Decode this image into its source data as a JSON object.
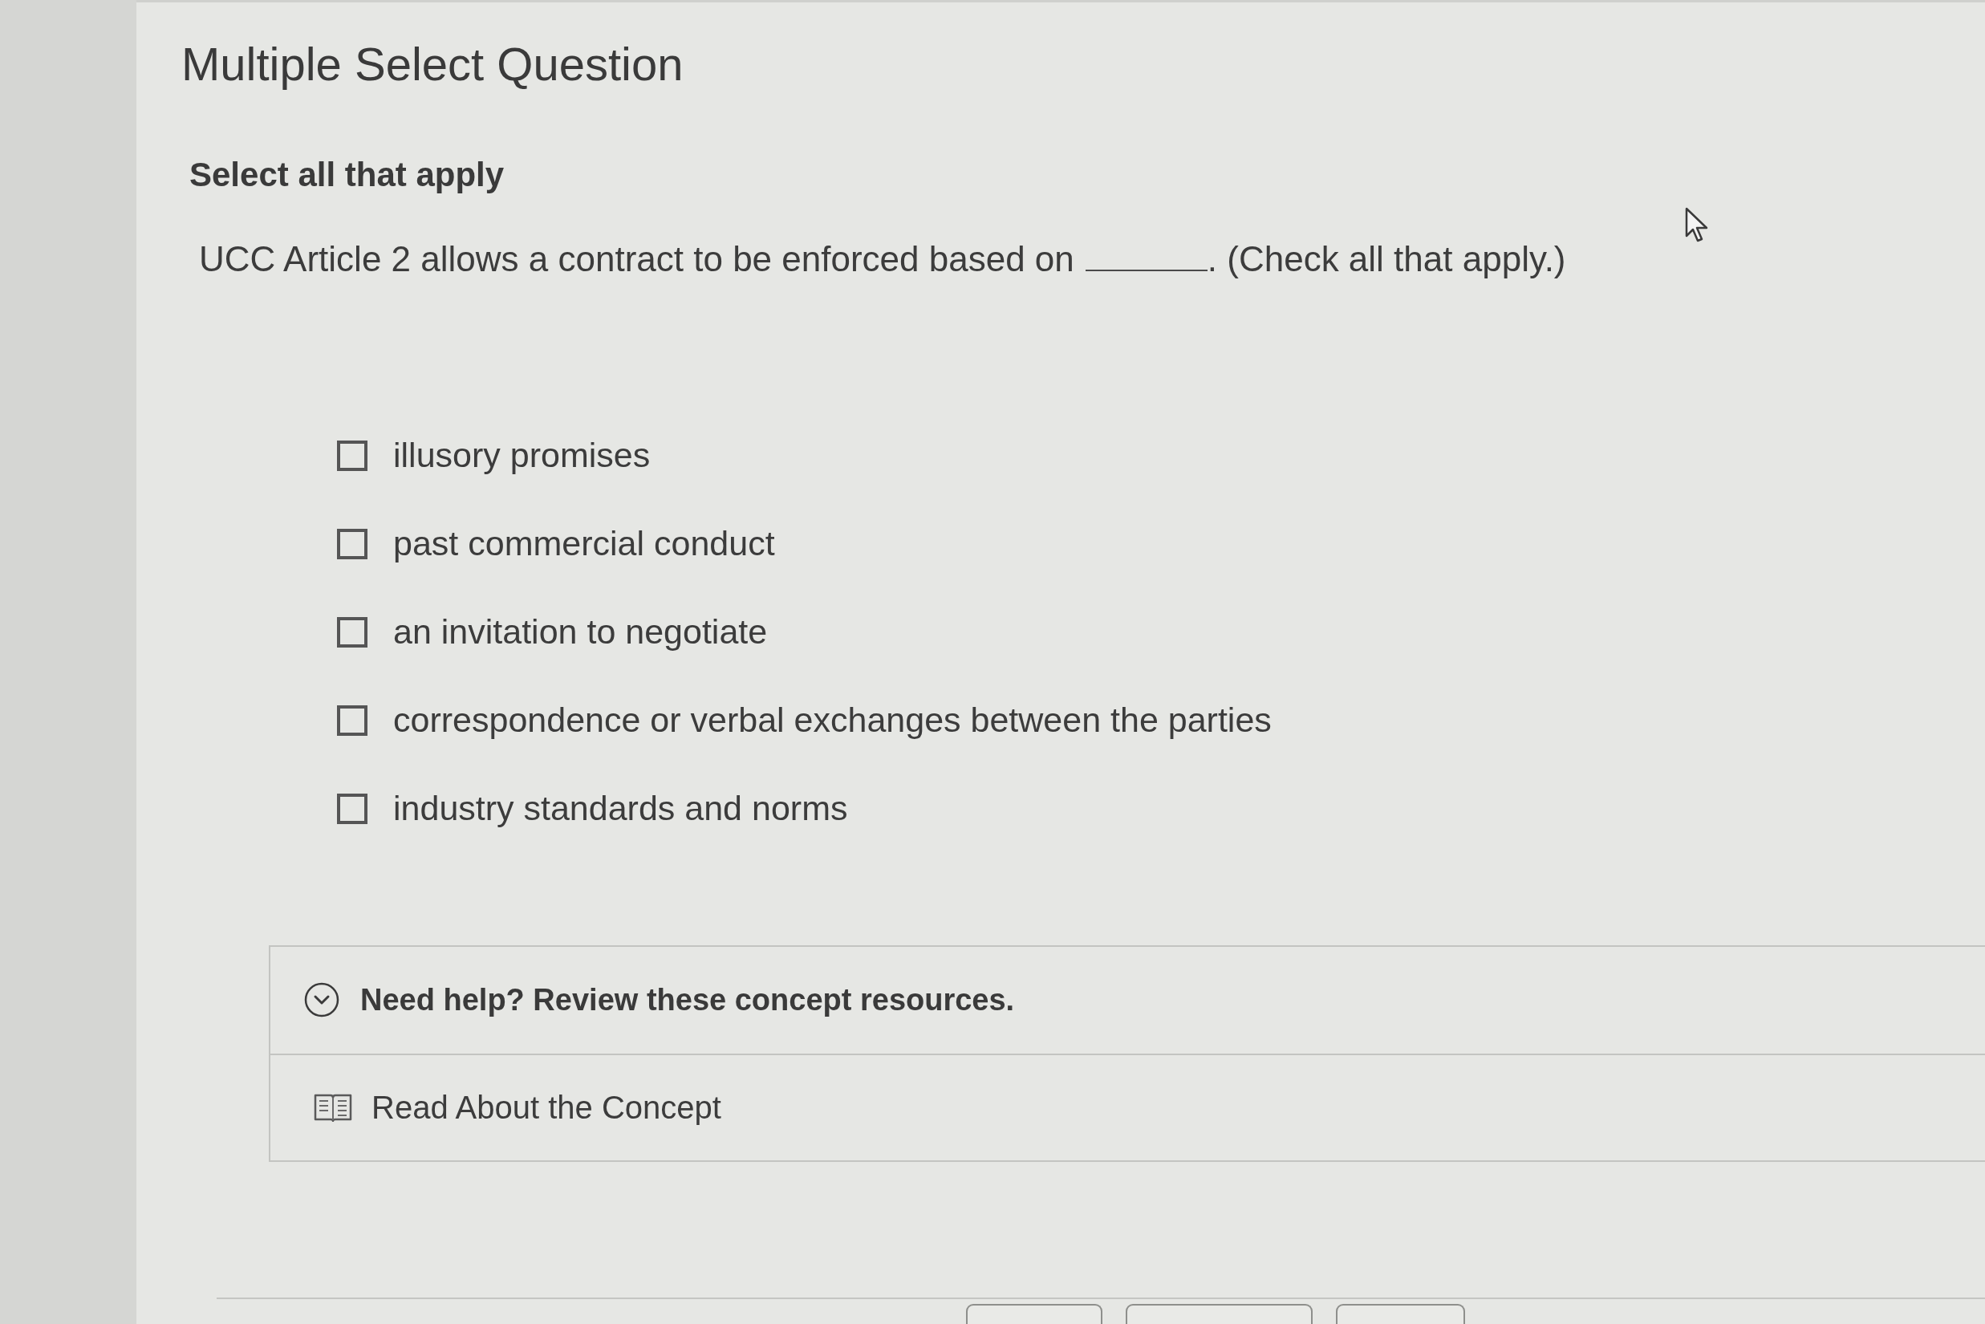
{
  "question_header": {
    "title": "Multiple Select Question"
  },
  "instruction": "Select all that apply",
  "prompt": [
    {
      "kind": "text",
      "text": "UCC Article 2 allows a contract to be enforced based on"
    },
    {
      "kind": "blank"
    },
    {
      "kind": "text",
      "text": ". (Check all that apply.)"
    }
  ],
  "options": [
    {
      "label": "illusory promises",
      "checked": false
    },
    {
      "label": "past commercial conduct",
      "checked": false
    },
    {
      "label": "an invitation to negotiate",
      "checked": false
    },
    {
      "label": "correspondence or verbal exchanges between the parties",
      "checked": false
    },
    {
      "label": "industry standards and norms",
      "checked": false
    }
  ],
  "help": {
    "title": "Need help? Review these concept resources.",
    "expanded": true,
    "resources": [
      {
        "kind": "reading",
        "label": "Read About the Concept"
      }
    ]
  },
  "footer": {
    "buttons": [
      {
        "kind": "outlined"
      },
      {
        "kind": "outlined"
      },
      {
        "kind": "outlined"
      }
    ]
  }
}
